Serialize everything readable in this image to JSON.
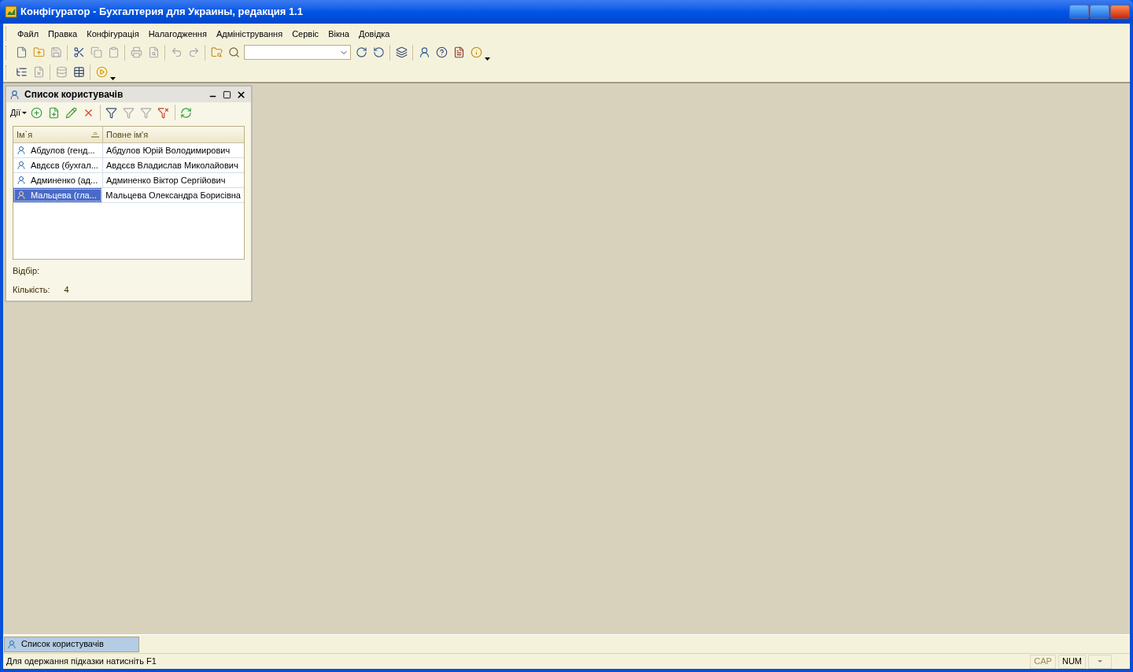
{
  "window": {
    "title": "Конфігуратор - Бухгалтерия для Украины, редакция 1.1"
  },
  "menu": [
    "Файл",
    "Правка",
    "Конфігурація",
    "Налагодження",
    "Адміністрування",
    "Сервіс",
    "Вікна",
    "Довідка"
  ],
  "toolbars": [
    [
      {
        "kind": "new",
        "disabled": false
      },
      {
        "kind": "open",
        "disabled": false
      },
      {
        "kind": "save",
        "disabled": true
      },
      {
        "kind": "separator"
      },
      {
        "kind": "cut",
        "disabled": false
      },
      {
        "kind": "copy",
        "disabled": true
      },
      {
        "kind": "paste",
        "disabled": true
      },
      {
        "kind": "separator"
      },
      {
        "kind": "print",
        "disabled": true
      },
      {
        "kind": "preview",
        "disabled": true
      },
      {
        "kind": "separator"
      },
      {
        "kind": "undo",
        "disabled": true
      },
      {
        "kind": "redo",
        "disabled": true
      },
      {
        "kind": "separator"
      },
      {
        "kind": "find-folder",
        "disabled": false
      },
      {
        "kind": "search",
        "disabled": false
      },
      {
        "kind": "combo",
        "disabled": false
      },
      {
        "kind": "find-next",
        "disabled": false
      },
      {
        "kind": "find-prev",
        "disabled": false
      },
      {
        "kind": "separator"
      },
      {
        "kind": "windows",
        "disabled": false
      },
      {
        "kind": "separator"
      },
      {
        "kind": "user",
        "disabled": false
      },
      {
        "kind": "help-search",
        "disabled": false
      },
      {
        "kind": "doc",
        "disabled": false
      },
      {
        "kind": "info",
        "disabled": false
      },
      {
        "kind": "more",
        "disabled": false
      }
    ],
    [
      {
        "kind": "tree",
        "disabled": false
      },
      {
        "kind": "close-doc",
        "disabled": true
      },
      {
        "kind": "separator"
      },
      {
        "kind": "database",
        "disabled": true
      },
      {
        "kind": "table",
        "disabled": false
      },
      {
        "kind": "separator"
      },
      {
        "kind": "play",
        "disabled": false
      },
      {
        "kind": "more",
        "disabled": false
      }
    ]
  ],
  "child_window": {
    "title": "Список користувачів",
    "toolbar": [
      {
        "kind": "actions",
        "label": "Дії",
        "disabled": false
      },
      {
        "kind": "add",
        "disabled": false
      },
      {
        "kind": "copy-add",
        "disabled": false
      },
      {
        "kind": "edit",
        "disabled": false
      },
      {
        "kind": "delete",
        "disabled": false
      },
      {
        "kind": "separator"
      },
      {
        "kind": "filter",
        "disabled": false
      },
      {
        "kind": "filter",
        "disabled": true
      },
      {
        "kind": "filter-menu",
        "disabled": true
      },
      {
        "kind": "filter-clear",
        "disabled": false
      },
      {
        "kind": "separator"
      },
      {
        "kind": "refresh",
        "disabled": false
      }
    ],
    "table": {
      "columns": [
        "Ім`я",
        "Повне ім'я"
      ],
      "rows": [
        {
          "name": "Абдулов (генд...",
          "full_name": "Абдулов Юрій Володимирович",
          "selected": false
        },
        {
          "name": "Авдєєв (бухгал...",
          "full_name": "Авдєєв Владислав Миколайович",
          "selected": false
        },
        {
          "name": "Админенко (ад...",
          "full_name": "Админенко Віктор Сергійович",
          "selected": false
        },
        {
          "name": "Мальцева (гла...",
          "full_name": "Мальцева Олександра Борисівна",
          "selected": true
        }
      ]
    },
    "filter_label": "Відбір:",
    "count_label": "Кількість:",
    "count": "4"
  },
  "taskbar": [
    {
      "label": "Список користувачів",
      "selected": true
    }
  ],
  "status_bar": {
    "hint": "Для одержання підказки натисніть F1",
    "indicators": [
      {
        "label": "CAP",
        "on": false
      },
      {
        "label": "NUM",
        "on": true
      }
    ]
  }
}
